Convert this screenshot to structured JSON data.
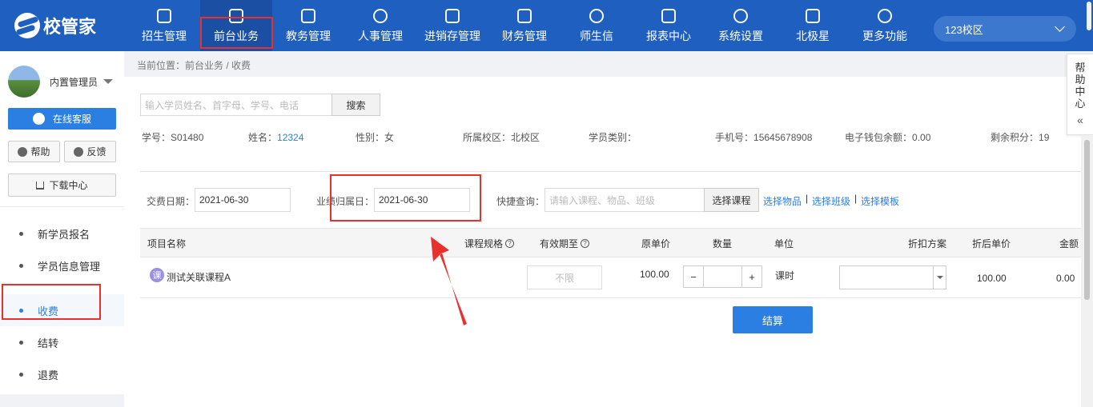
{
  "app": {
    "logo_text": "校管家",
    "accent_color": "#1f5fbf",
    "highlight_color": "#e8312f"
  },
  "nav": [
    {
      "label": "招生管理",
      "icon": "user-plus-icon"
    },
    {
      "label": "前台业务",
      "icon": "front-desk-icon",
      "active": true
    },
    {
      "label": "教务管理",
      "icon": "book-icon"
    },
    {
      "label": "人事管理",
      "icon": "person-icon"
    },
    {
      "label": "进销存管理",
      "icon": "inventory-icon"
    },
    {
      "label": "财务管理",
      "icon": "finance-icon"
    },
    {
      "label": "师生信",
      "icon": "message-icon"
    },
    {
      "label": "报表中心",
      "icon": "report-icon"
    },
    {
      "label": "系统设置",
      "icon": "settings-icon"
    },
    {
      "label": "北极星",
      "icon": "star-icon"
    },
    {
      "label": "更多功能",
      "icon": "more-icon"
    }
  ],
  "campus": {
    "selected": "123校区"
  },
  "sidebar": {
    "username": "内置管理员",
    "online_service": "在线客服",
    "help": "帮助",
    "feedback": "反馈",
    "download": "下载中心",
    "menu": [
      {
        "label": "新学员报名"
      },
      {
        "label": "学员信息管理"
      },
      {
        "label": "收费",
        "active": true
      },
      {
        "label": "结转"
      },
      {
        "label": "退费"
      }
    ]
  },
  "breadcrumb": "当前位置：前台业务 / 收费",
  "search": {
    "placeholder": "输入学员姓名、首字母、学号、电话",
    "button": "搜索"
  },
  "student": {
    "id_label": "学号：",
    "id": "S01480",
    "name_label": "姓名：",
    "name": "12324",
    "gender_label": "性别：",
    "gender": "女",
    "campus_label": "所属校区：",
    "campus": "北校区",
    "type_label": "学员类别：",
    "type": "",
    "phone_label": "手机号：",
    "phone": "15645678908",
    "wallet_label": "电子钱包余额：",
    "wallet": "0.00",
    "points_label": "剩余积分：",
    "points": "19"
  },
  "form": {
    "pay_date_label": "交费日期：",
    "pay_date": "2021-06-30",
    "business_date_label": "业绩归属日：",
    "business_date": "2021-06-30",
    "quick_label": "快捷查询：",
    "quick_placeholder": "请输入课程、物品、班级",
    "select_course": "选择课程",
    "select_item": "选择物品",
    "select_class": "选择班级",
    "select_template": "选择模板",
    "sep": "|"
  },
  "table": {
    "headers": [
      "项目名称",
      "课程规格",
      "有效期至",
      "原单价",
      "数量",
      "单位",
      "折扣方案",
      "折后单价",
      "金额"
    ],
    "rows": [
      {
        "badge": "课",
        "name": "测试关联课程A",
        "validity": "不限",
        "price": "100.00",
        "minus": "−",
        "plus": "+",
        "unit": "课时",
        "discounted": "100.00",
        "amount": "0.00"
      }
    ]
  },
  "checkout": "结算",
  "help_panel": {
    "text": [
      "帮",
      "助",
      "中",
      "心"
    ],
    "collapse": "«"
  }
}
